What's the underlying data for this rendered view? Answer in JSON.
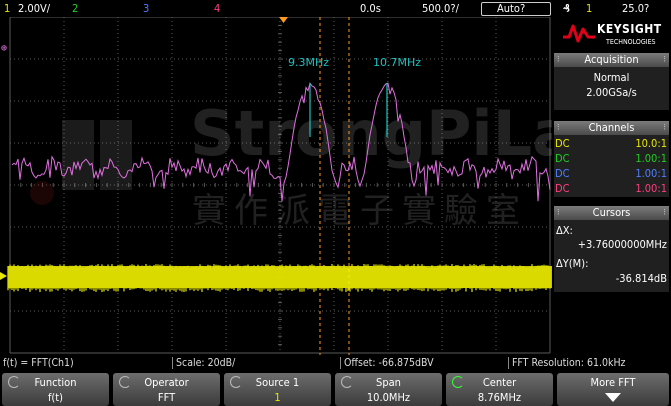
{
  "topbar": {
    "ch1_num": "1",
    "ch1_scale": "2.00V/",
    "ch2_num": "2",
    "ch3_num": "3",
    "ch4_num": "4",
    "time_offset": "0.0s",
    "time_scale": "500.0?/",
    "run_mode": "Auto?",
    "trigger_icon": "₰",
    "trigger_src": "1",
    "trigger_level": "25.0?"
  },
  "logo": {
    "name": "KEYSIGHT",
    "sub": "TECHNOLOGIES"
  },
  "acquisition": {
    "title": "Acquisition",
    "mode": "Normal",
    "rate": "2.00GSa/s"
  },
  "channels": {
    "title": "Channels",
    "rows": [
      {
        "coupling": "DC",
        "probe": "10.0:1",
        "color": "#e8e800"
      },
      {
        "coupling": "DC",
        "probe": "1.00:1",
        "color": "#1fcf1f"
      },
      {
        "coupling": "DC",
        "probe": "1.00:1",
        "color": "#4f7fff"
      },
      {
        "coupling": "DC",
        "probe": "1.00:1",
        "color": "#ff3f7f"
      }
    ]
  },
  "cursors": {
    "title": "Cursors",
    "dx_label": "ΔX:",
    "dx_value": "+3.76000000MHz",
    "dy_label": "ΔY(M):",
    "dy_value": "-36.814dB"
  },
  "markers": {
    "left": "9.3MHz",
    "right": "10.7MHz"
  },
  "watermark": {
    "line1": "StrongPiLab",
    "line2": "實作派電子實驗室"
  },
  "infobar": {
    "function": "f(t) = FFT(Ch1)",
    "scale": "Scale: 20dB/",
    "offset": "Offset: -66.875dBV",
    "resolution": "FFT Resolution: 61.0kHz"
  },
  "softkeys": [
    {
      "label": "Function",
      "value": "f(t)"
    },
    {
      "label": "Operator",
      "value": "FFT"
    },
    {
      "label": "Source 1",
      "value": "1"
    },
    {
      "label": "Span",
      "value": "10.0MHz"
    },
    {
      "label": "Center",
      "value": "8.76MHz"
    },
    {
      "label": "More FFT",
      "value": ""
    }
  ],
  "colors": {
    "ch1": "#e8e800",
    "math": "#e070e0",
    "marker": "#20c0c0",
    "cursor": "#ff9a1f",
    "grid": "#5a5a5a",
    "accent_logo": "#e0001a"
  }
}
